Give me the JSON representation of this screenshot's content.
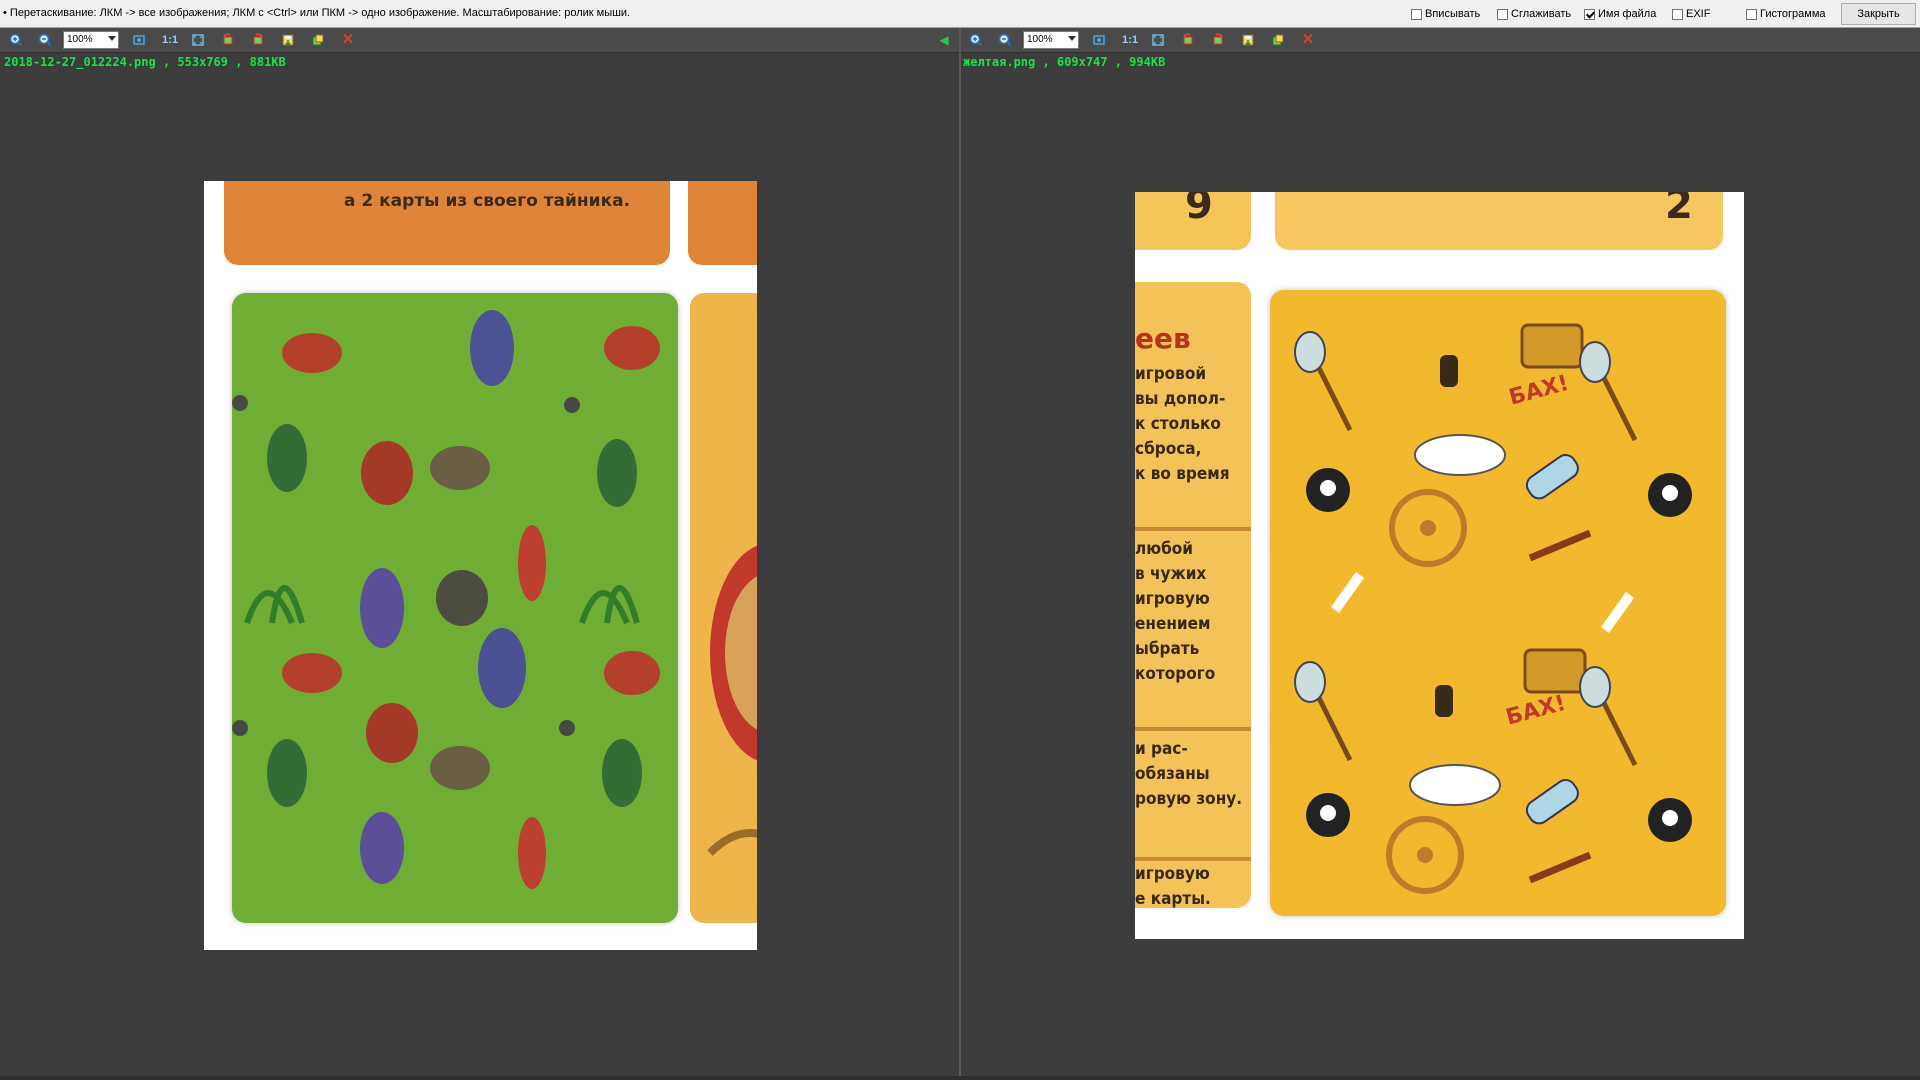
{
  "topbar": {
    "hint": "• Перетаскивание: ЛКМ -> все изображения; ЛКМ с <Ctrl> или ПКМ -> одно изображение. Масштабирование: ролик мыши.",
    "options": [
      {
        "label": "Вписывать",
        "checked": false
      },
      {
        "label": "Сглаживать",
        "checked": false
      },
      {
        "label": "Имя файла",
        "checked": true
      },
      {
        "label": "EXIF",
        "checked": false
      },
      {
        "label": "Гистограмма",
        "checked": false
      }
    ],
    "close_label": "Закрыть"
  },
  "left_panel": {
    "zoom": "100%",
    "fit_label": "1:1",
    "file_info": "2018-12-27_012224.png , 553x769 , 881KB",
    "card_text": "а 2 карты из своего тайника."
  },
  "right_panel": {
    "zoom": "100%",
    "fit_label": "1:1",
    "file_info": "желтая.png , 609x747 , 994KB",
    "digits": [
      "9",
      "2"
    ],
    "heading_fragment": "еев",
    "text_lines": [
      "игровой",
      "вы допол-",
      "к столько",
      "сброса,",
      "к во время",
      "любой",
      "в чужих",
      "игровую",
      "енением",
      "ыбрать",
      "которого",
      "и рас-",
      "обязаны",
      "ровую зону.",
      "игровую",
      "е карты."
    ],
    "sfx": "БАХ!"
  },
  "colors": {
    "background": "#3c3c3c",
    "file_info": "#17e24a",
    "green_card": "#6fad35",
    "yellow_card": "#f3b92e",
    "orange_card": "#e28a3c"
  }
}
